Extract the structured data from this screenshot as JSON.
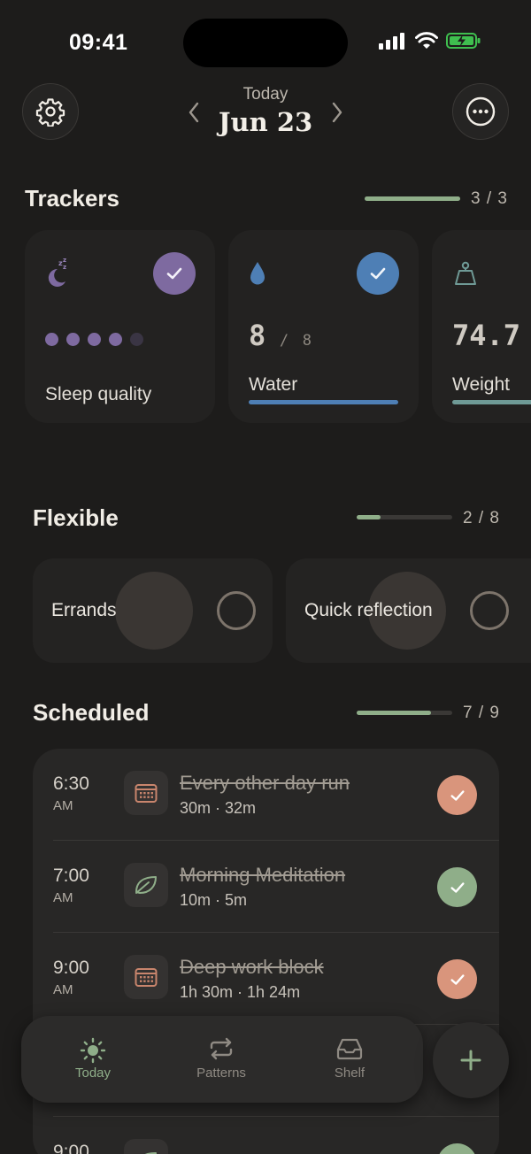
{
  "status_bar": {
    "time": "09:41"
  },
  "header": {
    "eyebrow": "Today",
    "date": "Jun 23"
  },
  "trackers": {
    "title": "Trackers",
    "progress": {
      "text": "3 / 3",
      "fraction": 1.0
    },
    "cards": [
      {
        "label": "Sleep quality",
        "icon": "moon-sleep-icon",
        "rating": 4,
        "rating_max": 5,
        "done": true,
        "accent": "#7e6aa0"
      },
      {
        "label": "Water",
        "icon": "water-drop-icon",
        "value": "8",
        "goal": "8",
        "done": true,
        "accent": "#4e7fb5"
      },
      {
        "label": "Weight",
        "icon": "scale-icon",
        "value": "74.7",
        "accent": "#6f9a96"
      }
    ]
  },
  "flexible": {
    "title": "Flexible",
    "progress": {
      "text": "2 / 8",
      "fraction": 0.25
    },
    "items": [
      {
        "label": "Errands",
        "done": false
      },
      {
        "label": "Quick reflection",
        "done": false
      }
    ]
  },
  "scheduled": {
    "title": "Scheduled",
    "progress": {
      "text": "7 / 9",
      "fraction": 0.78
    },
    "items": [
      {
        "time": "6:30",
        "ampm": "AM",
        "title": "Every other day run",
        "sub": "30m · 32m",
        "icon": "calendar-icon",
        "check_color": "#d9957c"
      },
      {
        "time": "7:00",
        "ampm": "AM",
        "title": "Morning Meditation",
        "sub": "10m · 5m",
        "icon": "leaf-icon",
        "check_color": "#8fae89"
      },
      {
        "time": "9:00",
        "ampm": "AM",
        "title": "Deep work block",
        "sub": "1h 30m · 1h 24m",
        "icon": "calendar-icon",
        "check_color": "#d9957c"
      },
      {
        "time": "9:00",
        "ampm": "",
        "title": "",
        "sub": "",
        "icon": "leaf-icon",
        "check_color": "#8fae89"
      }
    ]
  },
  "tab_bar": {
    "tabs": [
      {
        "label": "Today",
        "icon": "sun-icon",
        "active": true
      },
      {
        "label": "Patterns",
        "icon": "repeat-icon",
        "active": false
      },
      {
        "label": "Shelf",
        "icon": "inbox-tray-icon",
        "active": false
      }
    ],
    "add_icon": "plus-icon"
  },
  "colors": {
    "background": "#1d1c1b",
    "accent_green": "#8fae89",
    "sleep_purple": "#7e6aa0",
    "water_blue": "#4e7fb5"
  }
}
